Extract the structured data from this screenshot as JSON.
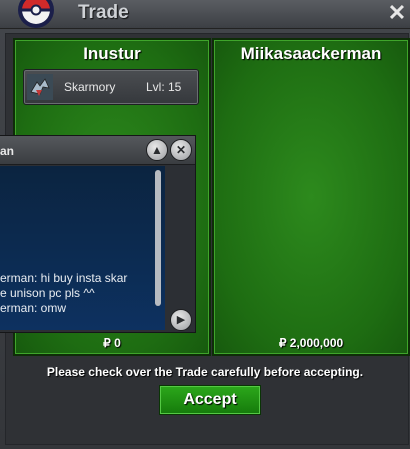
{
  "window": {
    "title": "Trade",
    "close_icon": "close-icon"
  },
  "left_panel": {
    "player_name": "Inustur",
    "item": {
      "name": "Skarmory",
      "level": "Lvl: 15",
      "icon": "skarmory-icon"
    },
    "money": "₽ 0"
  },
  "right_panel": {
    "player_name": "Miikasaackerman",
    "money": "₽ 2,000,000"
  },
  "chat": {
    "title": "an",
    "lines": [
      "erman: hi buy insta skar",
      "e unison pc pls ^^",
      "erman: omw"
    ]
  },
  "notice": "Please check over the Trade carefully before accepting.",
  "accept_label": "Accept",
  "colors": {
    "panel_green": "#1e6d12",
    "accent": "#2ca81b",
    "chat_bg": "#0d3160"
  }
}
